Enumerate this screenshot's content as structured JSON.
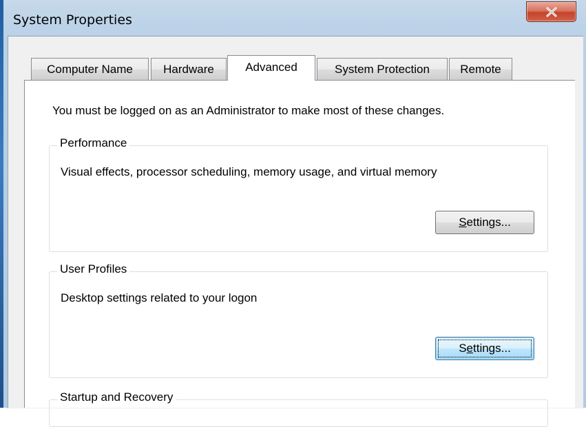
{
  "window": {
    "title": "System Properties",
    "close_icon": "close-icon"
  },
  "tabs": [
    {
      "label": "Computer Name",
      "active": false
    },
    {
      "label": "Hardware",
      "active": false
    },
    {
      "label": "Advanced",
      "active": true
    },
    {
      "label": "System Protection",
      "active": false
    },
    {
      "label": "Remote",
      "active": false
    }
  ],
  "advanced": {
    "intro": "You must be logged on as an Administrator to make most of these changes.",
    "performance": {
      "label": "Performance",
      "description": "Visual effects, processor scheduling, memory usage, and virtual memory",
      "button_pre": "",
      "button_mnemonic": "S",
      "button_post": "ettings..."
    },
    "user_profiles": {
      "label": "User Profiles",
      "description": "Desktop settings related to your logon",
      "button_pre": "S",
      "button_mnemonic": "e",
      "button_post": "ttings..."
    },
    "startup_recovery": {
      "label": "Startup and Recovery"
    }
  },
  "colors": {
    "frame": "#bcd2e8",
    "close_button": "#c4442b",
    "focused_button_border": "#3c7fb1",
    "panel_background": "#ffffff"
  }
}
